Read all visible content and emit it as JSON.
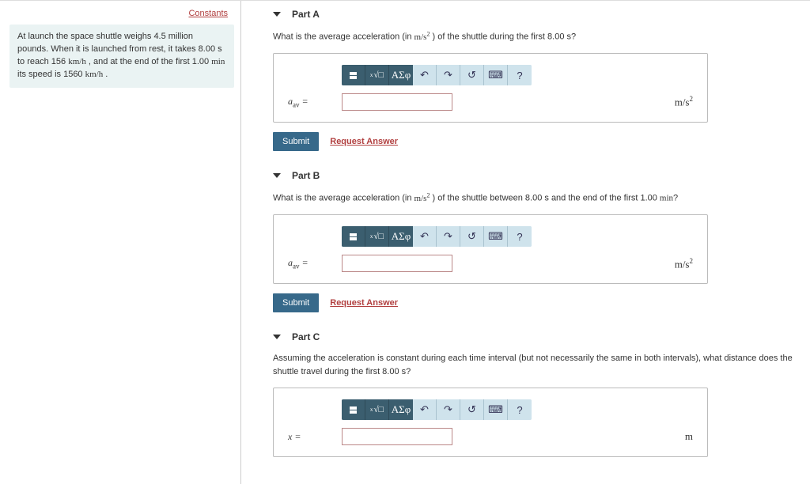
{
  "sidebar": {
    "constants_label": "Constants",
    "problem_text_1": "At launch the space shuttle weighs 4.5 million pounds. When it is launched from rest, it takes 8.00 s to reach 156 ",
    "problem_unit_1": "km/h",
    "problem_text_2": " , and at the end of the first 1.00 ",
    "problem_unit_2": "min",
    "problem_text_3": " its speed is 1560 ",
    "problem_unit_3": "km/h",
    "problem_text_4": " ."
  },
  "parts": {
    "a": {
      "title": "Part A",
      "prompt_1": "What is the average acceleration (in ",
      "prompt_unit": "m/s",
      "prompt_2": " ) of the shuttle during the first 8.00 s?",
      "var_a": "a",
      "var_sub": "av",
      "eq": " = ",
      "unit_base": "m/s",
      "submit": "Submit",
      "request": "Request Answer",
      "help": "?"
    },
    "b": {
      "title": "Part B",
      "prompt_1": "What is the average acceleration (in ",
      "prompt_unit": "m/s",
      "prompt_2": " ) of the shuttle between 8.00 s and the end of the first 1.00 ",
      "prompt_unit2": "min",
      "prompt_3": "?",
      "var_a": "a",
      "var_sub": "av",
      "eq": " = ",
      "unit_base": "m/s",
      "submit": "Submit",
      "request": "Request Answer",
      "help": "?"
    },
    "c": {
      "title": "Part C",
      "prompt_1": "Assuming the acceleration is constant during each time interval (but not necessarily the same in both intervals), what distance does the shuttle travel during the first 8.00 s?",
      "var_x": "x",
      "eq": " = ",
      "unit_base": "m",
      "help": "?"
    }
  },
  "toolbar": {
    "greek": "ΑΣφ"
  }
}
